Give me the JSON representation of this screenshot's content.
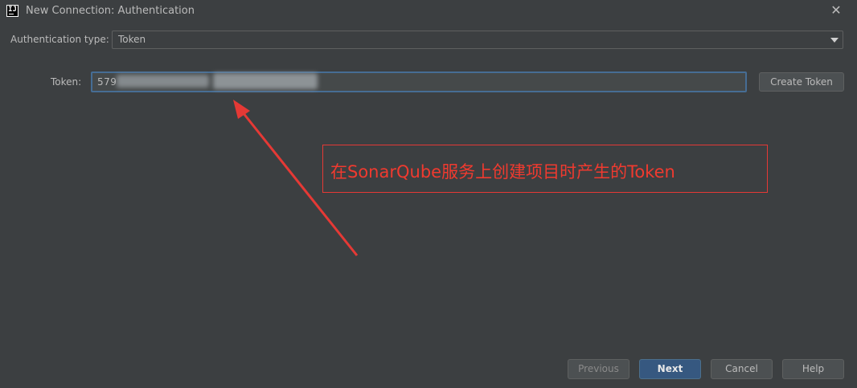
{
  "window": {
    "title": "New Connection: Authentication",
    "app_icon_text": "IJ"
  },
  "auth": {
    "label": "Authentication type:",
    "selected": "Token"
  },
  "token": {
    "label": "Token:",
    "value": "579"
  },
  "create_token_label": "Create Token",
  "annotation": {
    "text": "在SonarQube服务上创建项目时产生的Token",
    "color": "#e53935"
  },
  "footer": {
    "previous": "Previous",
    "next": "Next",
    "cancel": "Cancel",
    "help": "Help"
  },
  "colors": {
    "background": "#3c3f41",
    "primary_button": "#365880",
    "focus_border": "#466d94"
  }
}
